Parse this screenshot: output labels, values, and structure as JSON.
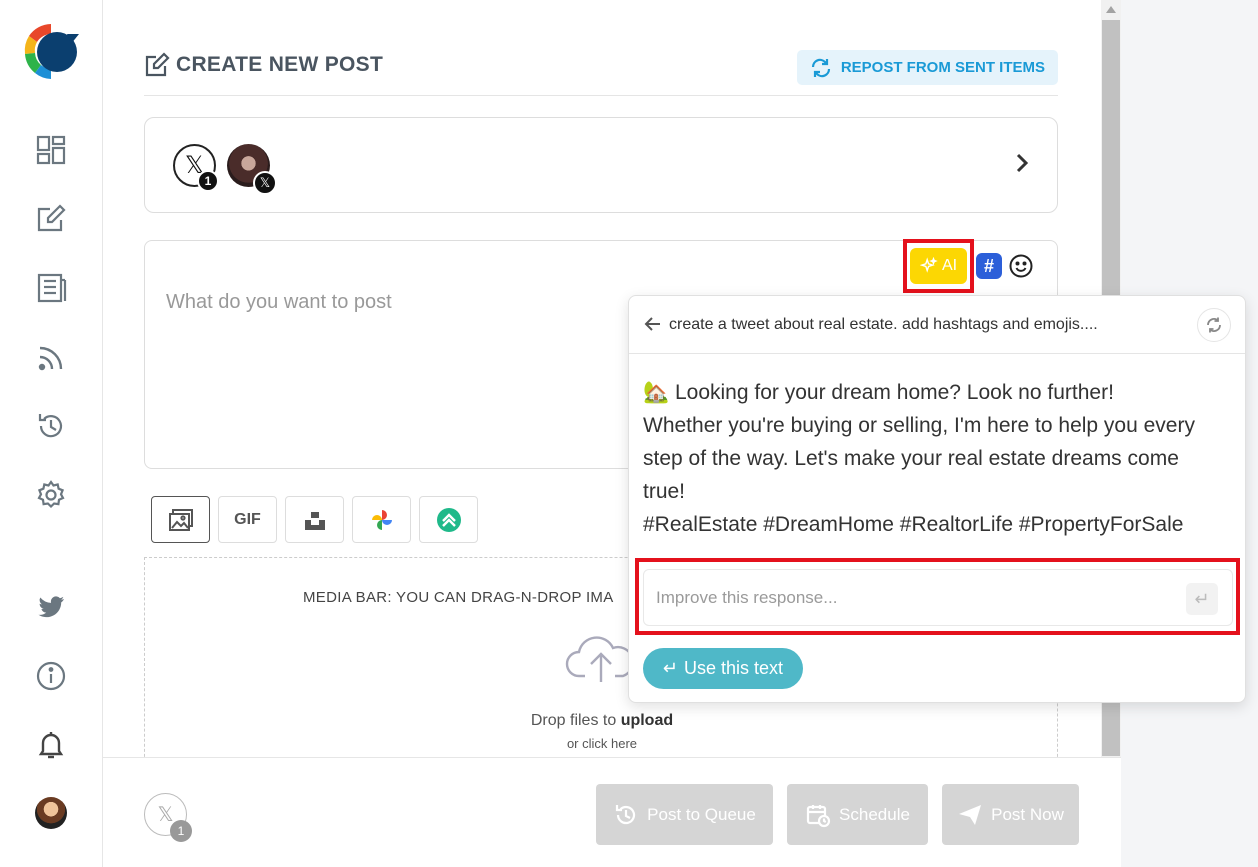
{
  "sidebar": {
    "items": [
      {
        "icon": "dashboard-icon"
      },
      {
        "icon": "edit-icon"
      },
      {
        "icon": "article-icon"
      },
      {
        "icon": "rss-icon"
      },
      {
        "icon": "history-icon"
      },
      {
        "icon": "settings-icon"
      },
      {
        "icon": "twitter-icon"
      },
      {
        "icon": "info-icon"
      },
      {
        "icon": "bell-icon"
      }
    ]
  },
  "header": {
    "title": "CREATE NEW POST",
    "repost_label": "REPOST FROM SENT ITEMS"
  },
  "accounts": {
    "x_count": "1",
    "x_glyph": "𝕏"
  },
  "composer": {
    "placeholder": "What do you want to post",
    "ai_label": "AI",
    "hashtag_glyph": "#"
  },
  "media": {
    "gif_label": "GIF",
    "caption": "MEDIA BAR: YOU CAN DRAG-N-DROP IMA",
    "drop_prefix": "Drop files to ",
    "drop_bold": "upload",
    "click_text": "or click here"
  },
  "ai_panel": {
    "prompt": "create a tweet about real estate. add hashtags and emojis....",
    "response_lines": [
      "🏡 Looking for your dream home? Look no further!",
      "Whether you're buying or selling, I'm here to help you every",
      "step of the way. Let's make your real estate dreams come",
      "true!",
      "#RealEstate #DreamHome #RealtorLife #PropertyForSale"
    ],
    "improve_placeholder": "Improve this response...",
    "use_label": "Use this text",
    "enter_glyph": "↵"
  },
  "footer": {
    "x_count": "1",
    "queue_label": "Post to Queue",
    "schedule_label": "Schedule",
    "post_now_label": "Post Now"
  },
  "colors": {
    "accent_blue": "#1a9ad6",
    "ai_yellow": "#fcd703",
    "highlight_red": "#e4111c",
    "use_button": "#4fb8c8",
    "disabled_button": "#d5d5d5"
  }
}
